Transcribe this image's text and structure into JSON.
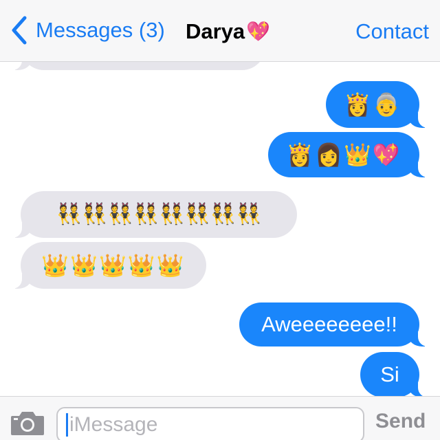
{
  "nav": {
    "back_label": "Messages (3)",
    "title": "Darya",
    "title_emoji": "💖",
    "contact_label": "Contact",
    "accent_color": "#1a7cf3"
  },
  "messages": [
    {
      "direction": "received",
      "type": "emoji",
      "content": ""
    },
    {
      "direction": "sent",
      "type": "emoji",
      "content": "👸👵"
    },
    {
      "direction": "sent",
      "type": "emoji",
      "content": "👸👩👑💖"
    },
    {
      "direction": "received",
      "type": "emoji",
      "content": "👯👯👯👯👯👯👯👯"
    },
    {
      "direction": "received",
      "type": "emoji",
      "content": "👑👑👑👑👑"
    },
    {
      "direction": "sent",
      "type": "text",
      "content": "Aweeeeeeee!!"
    },
    {
      "direction": "sent",
      "type": "text",
      "content": "Si"
    }
  ],
  "colors": {
    "sent_bubble": "#1a86fb",
    "received_bubble": "#e6e5eb"
  },
  "input": {
    "placeholder": "iMessage",
    "send_label": "Send",
    "camera_icon": "camera-icon"
  }
}
